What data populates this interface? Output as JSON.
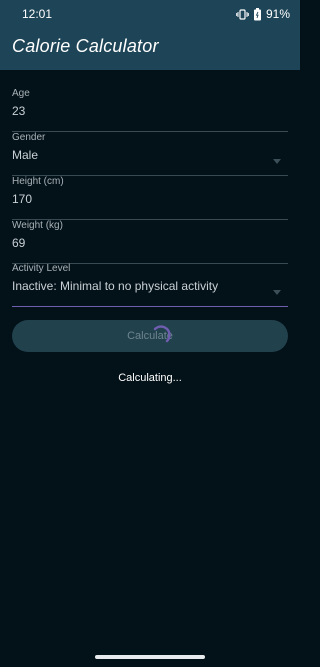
{
  "status_bar": {
    "time": "12:01",
    "battery": "91%",
    "icons": [
      "vibrate-icon",
      "battery-icon"
    ]
  },
  "app": {
    "title": "Calorie Calculator"
  },
  "form": {
    "age": {
      "label": "Age",
      "value": "23"
    },
    "gender": {
      "label": "Gender",
      "value": "Male"
    },
    "height": {
      "label": "Height (cm)",
      "value": "170"
    },
    "weight": {
      "label": "Weight (kg)",
      "value": "69"
    },
    "activity": {
      "label": "Activity Level",
      "value": "Inactive: Minimal to no physical activity"
    }
  },
  "calculate_button": {
    "label": "Calculate"
  },
  "status_message": "Calculating...",
  "colors": {
    "header": "#1e4557",
    "background": "#031118",
    "accent": "#6f5db0",
    "button": "#21414d"
  }
}
